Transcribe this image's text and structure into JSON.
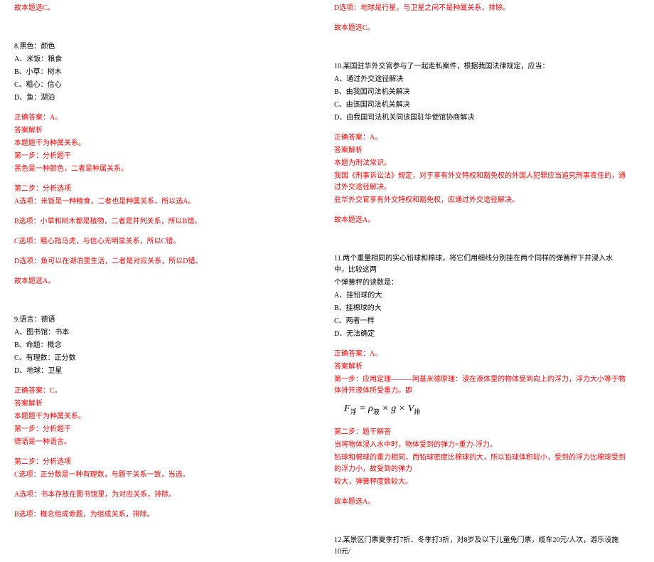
{
  "left": {
    "top_answer": "故本题选C。",
    "q8": {
      "stem": "8.黑色：颜色",
      "A": "A、米饭：粮食",
      "B": "B、小草：树木",
      "C": "C、粗心：信心",
      "D": "D、鱼：湖泊",
      "ans": "正确答案：A。",
      "expl_h": "答案解析",
      "l1": "本题题干为种属关系。",
      "l2": "第一步：分析题干",
      "l3": "黑色是一种颜色，二者是种属关系。",
      "step2": "第二步：分析选项",
      "oA": "A选项：米饭是一种粮食，二者也是种属关系，所以选A。",
      "oB": "B选项：小草和树木都是植物，二者是并列关系，所以B错。",
      "oC": "C选项：粗心指马虎，与信心无明显关系，所以C错。",
      "oD": "D选项：鱼可以在湖泊里生活，二者是对应关系，所以D错。",
      "end": "故本题选A。"
    },
    "q9": {
      "stem": "9.语言：德语",
      "A": "A、图书馆：书本",
      "B": "B、命题：概念",
      "C": "C、有理数：正分数",
      "D": "D、地球：卫星",
      "ans": "正确答案：C。",
      "expl_h": "答案解析",
      "l1": "本题题干为种属关系。",
      "l2": "第一步：分析题干",
      "l3": "德语是一种语言。",
      "step2": "第二步：分析选项",
      "oC": "C选项：正分数是一种有理数，与题干关系一致，当选。",
      "oA": "A选项：书本存放在图书馆里，为对应关系，排除。",
      "oB": "B选项：概念组成命题，为组成关系，排除。"
    }
  },
  "right": {
    "q9d": "D选项：地球是行星，与卫星之间不是种属关系，排除。",
    "q9end": "故本题选C。",
    "q10": {
      "stem": "10.某国驻华外交官参与了一起走私案件，根据我国法律规定，应当：",
      "A": "A、通过外交途径解决",
      "B": "B、由我国司法机关解决",
      "C": "C、由该国司法机关解决",
      "D": "D、由我国司法机关同该国驻华使馆协商解决",
      "ans": "正确答案：A。",
      "expl_h": "答案解析",
      "l1": "本题为刑法常识。",
      "l2": "我国《刑事诉讼法》规定，对于享有外交特权和豁免权的外国人犯罪应当追究刑事责任的，通过外交途径解决。",
      "l3": "驻华外交官享有外交特权和豁免权，应通过外交途径解决。",
      "end": "故本题选A。"
    },
    "q11": {
      "stem1": "11.两个重量相同的实心铅球和棉球，将它们用细线分别挂在两个同样的弹簧秤下并浸入水中，比较这两",
      "stem2": "个弹簧秤的读数是：",
      "A": "A、挂铅球的大",
      "B": "B、挂棉球的大",
      "C": "C、两者一样",
      "D": "D、无法确定",
      "ans": "正确答案：A。",
      "expl_h": "答案解析",
      "l1": "第一步：应用定理———阿基米德原理：浸在液体里的物体受到向上的浮力，浮力大小等于物体排开液体所受重力。即",
      "step2": "第二步：题干解答",
      "l2": "当将物体浸入水中时，物体受到的弹力=重力-浮力。",
      "l3": "铅球和棉球的重力相同，而铅球密度比棉球的大，所以铅球体积较小，受到的浮力比棉球受到的浮力小，故受到的弹力",
      "l4": "较大，弹簧秤度数较大。",
      "end": "故本题选A。"
    },
    "q12": {
      "stem": "12.某景区门票夏季打7折、冬季打3折，对8岁及以下儿童免门票，缆车20元/人次，游乐设施10元/"
    }
  },
  "formula": {
    "lhs": "F",
    "sub1": "浮",
    "eq": " = ",
    "rho": "ρ",
    "sub2": "液",
    "mul1": " × ",
    "g": "g",
    "mul2": " × ",
    "V": "V",
    "sub3": "排"
  }
}
